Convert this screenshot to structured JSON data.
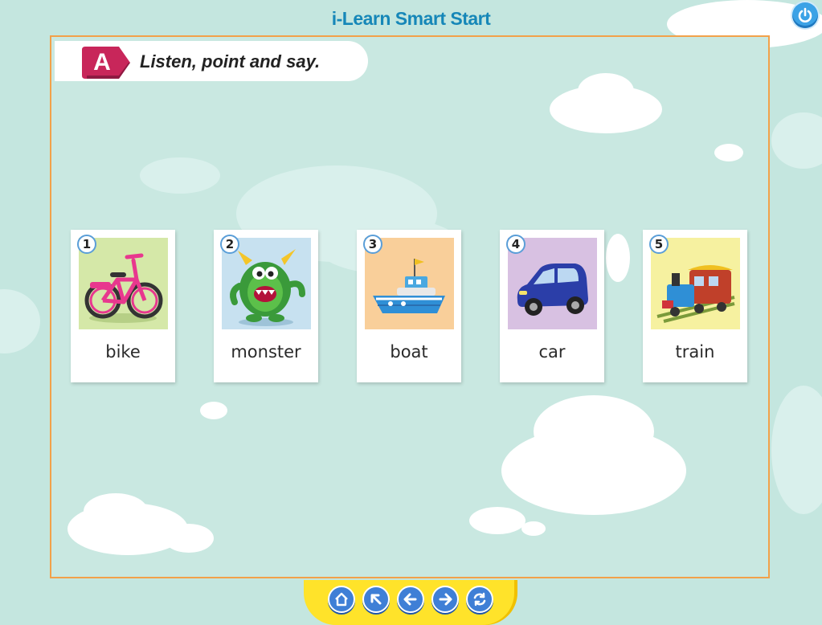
{
  "app": {
    "title": "i-Learn Smart Start"
  },
  "header": {
    "power_icon": "power-icon"
  },
  "activity": {
    "badge": "A",
    "instruction": "Listen, point and say."
  },
  "cards": [
    {
      "number": "1",
      "word": "bike",
      "icon": "bike-icon",
      "bg": "#d5e8a8"
    },
    {
      "number": "2",
      "word": "monster",
      "icon": "monster-icon",
      "bg": "#c7e1f0"
    },
    {
      "number": "3",
      "word": "boat",
      "icon": "boat-icon",
      "bg": "#f9cf9a"
    },
    {
      "number": "4",
      "word": "car",
      "icon": "car-icon",
      "bg": "#d8c1e2"
    },
    {
      "number": "5",
      "word": "train",
      "icon": "train-icon",
      "bg": "#f6f1a0"
    }
  ],
  "nav": {
    "buttons": [
      "home-icon",
      "up-left-arrow-icon",
      "back-arrow-icon",
      "forward-arrow-icon",
      "refresh-icon"
    ]
  },
  "colors": {
    "title": "#1687b8",
    "badge": "#c8265a",
    "frame_border": "#f2a14a",
    "nav_bar": "#ffe32a"
  }
}
